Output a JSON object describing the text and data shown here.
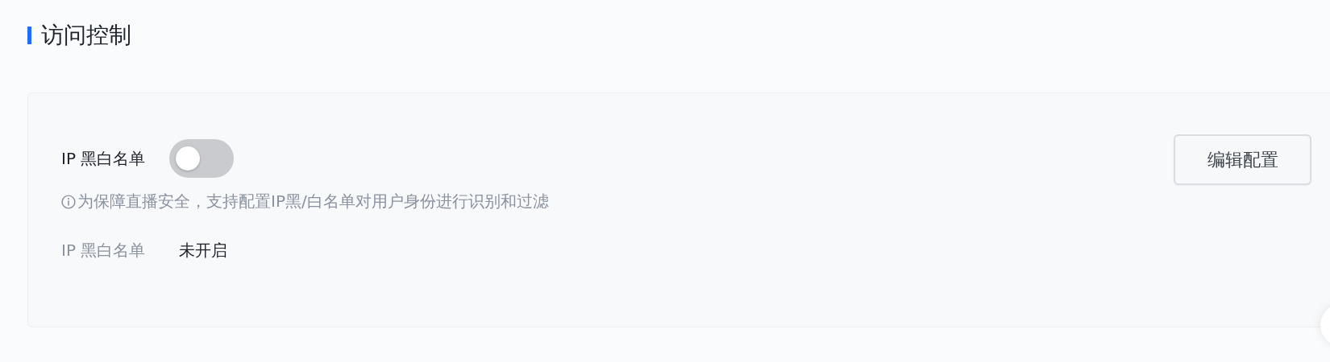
{
  "section_title": "访问控制",
  "setting": {
    "label": "IP 黑白名单",
    "on": false
  },
  "edit_button": "编辑配置",
  "hint": "为保障直播安全，支持配置IP黑/白名单对用户身份进行识别和过滤",
  "status": {
    "label": "IP 黑白名单",
    "value": "未开启"
  }
}
